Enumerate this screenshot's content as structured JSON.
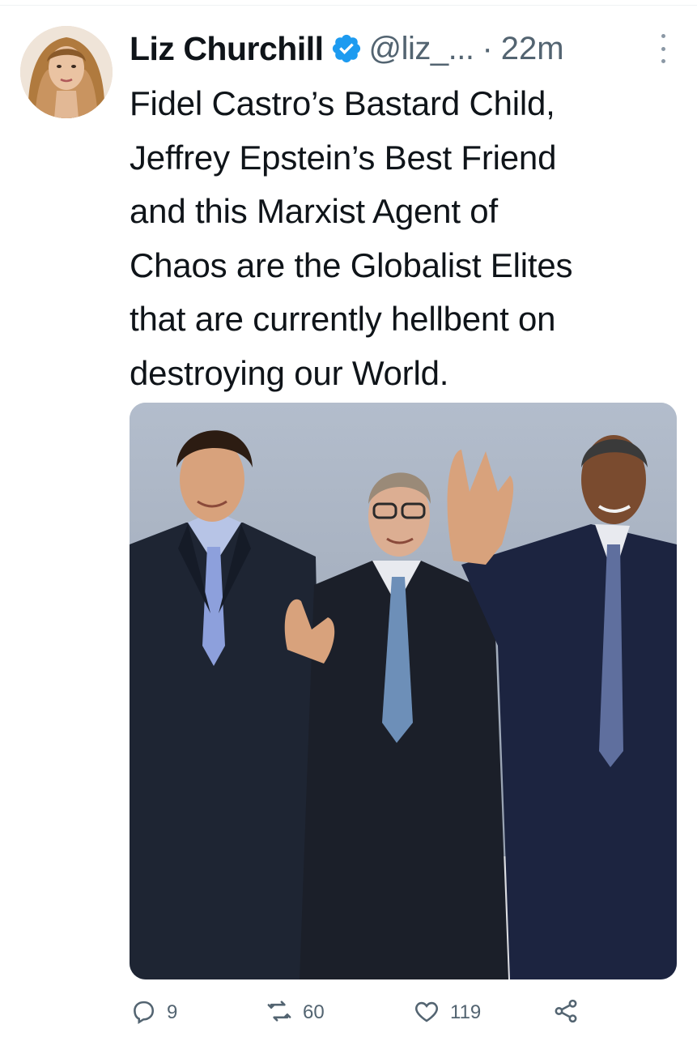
{
  "author": {
    "display_name": "Liz Churchill",
    "handle": "@liz_...",
    "separator": "·",
    "time": "22m",
    "verified": true
  },
  "tweet": {
    "lines": [
      "Fidel Castro’s Bastard Child,",
      "Jeffrey Epstein’s Best Friend",
      "and this Marxist Agent of",
      "Chaos are the Globalist Elites",
      "that are currently hellbent on",
      "destroying our World."
    ]
  },
  "actions": {
    "reply_count": "9",
    "retweet_count": "60",
    "like_count": "119"
  },
  "colors": {
    "verified_blue": "#1d9bf0",
    "secondary_text": "#536471",
    "primary_text": "#0f1419"
  },
  "icons": [
    "avatar",
    "verified-badge-icon",
    "more-icon",
    "reply-icon",
    "retweet-icon",
    "like-icon",
    "share-icon"
  ]
}
